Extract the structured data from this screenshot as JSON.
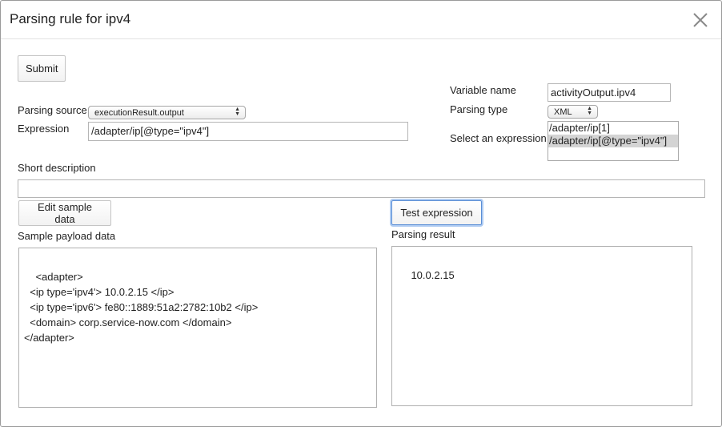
{
  "dialog": {
    "title": "Parsing rule for ipv4"
  },
  "toolbar": {
    "submit_label": "Submit"
  },
  "form": {
    "variable_name_label": "Variable name",
    "variable_name_value": "activityOutput.ipv4",
    "parsing_type_label": "Parsing type",
    "parsing_type_value": "XML",
    "parsing_source_label": "Parsing source",
    "parsing_source_value": "executionResult.output",
    "expression_label": "Expression",
    "expression_value": "/adapter/ip[@type=\"ipv4\"]",
    "select_expression_label": "Select an expression",
    "expression_options": [
      {
        "label": "/adapter/ip[1]",
        "selected": false
      },
      {
        "label": "/adapter/ip[@type=\"ipv4\"]",
        "selected": true
      }
    ],
    "short_description_label": "Short description",
    "short_description_value": ""
  },
  "sample": {
    "edit_button_label": "Edit sample data",
    "label": "Sample payload data",
    "payload": "<adapter>\n  <ip type='ipv4'> 10.0.2.15 </ip>\n  <ip type='ipv6'> fe80::1889:51a2:2782:10b2 </ip>\n  <domain> corp.service-now.com </domain>\n</adapter>"
  },
  "result": {
    "test_button_label": "Test expression",
    "label": "Parsing result",
    "value": "10.0.2.15"
  },
  "icons": {
    "close": "close-icon",
    "resize": "resize-grip-icon",
    "select_arrows": "select-arrows-icon"
  }
}
